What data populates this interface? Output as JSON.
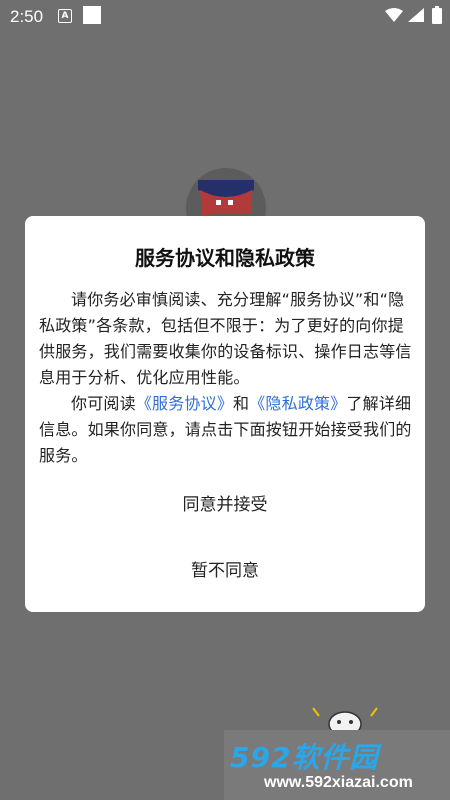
{
  "status_bar": {
    "time": "2:50",
    "icons": [
      "accessibility-a-icon",
      "notification-square-icon",
      "wifi-icon",
      "signal-icon",
      "battery-icon"
    ]
  },
  "app_logo": {
    "icon": "chat-bubble-logo-icon"
  },
  "dialog": {
    "title": "服务协议和隐私政策",
    "paragraph1": "请你务必审慎阅读、充分理解“服务协议”和“隐私政策”各条款，包括但不限于：为了更好的向你提供服务，我们需要收集你的设备标识、操作日志等信息用于分析、优化应用性能。",
    "p2_prefix": "你可阅读",
    "link_service": "《服务协议》",
    "p2_and": "和",
    "link_privacy": "《隐私政策》",
    "p2_suffix": "了解详细信息。如果你同意，请点击下面按钮开始接受我们的服务。",
    "agree_button": "同意并接受",
    "decline_button": "暂不同意"
  },
  "watermark": {
    "brand": "592软件园",
    "url": "www.592xiazai.com"
  },
  "colors": {
    "overlay": "#6f6f6f",
    "link": "#2f6fd6",
    "watermark_brand": "#2aa7ea"
  }
}
